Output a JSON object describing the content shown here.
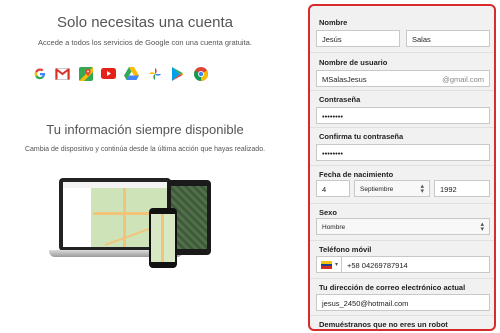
{
  "left": {
    "title1": "Solo necesitas una cuenta",
    "subtitle1": "Accede a todos los servicios de Google con una cuenta gratuita.",
    "title2": "Tu información siempre disponible",
    "subtitle2": "Cambia de dispositivo y continúa desde la última acción que hayas realizado.",
    "icons": [
      "google-icon",
      "gmail-icon",
      "maps-icon",
      "youtube-icon",
      "drive-icon",
      "photos-icon",
      "play-icon",
      "chrome-icon"
    ]
  },
  "form": {
    "name_label": "Nombre",
    "first_name": "Jesús",
    "last_name": "Salas",
    "username_label": "Nombre de usuario",
    "username": "MSalasJesus",
    "username_suffix": "@gmail.com",
    "password_label": "Contraseña",
    "password": "••••••••",
    "confirm_label": "Confirma tu contraseña",
    "confirm": "••••••••",
    "birth_label": "Fecha de nacimiento",
    "birth_day": "4",
    "birth_month": "Septiembre",
    "birth_year": "1992",
    "gender_label": "Sexo",
    "gender": "Hombre",
    "phone_label": "Teléfono móvil",
    "phone": "+58 04269787914",
    "email_label": "Tu dirección de correo electrónico actual",
    "email": "jesus_2450@hotmail.com",
    "captcha_label": "Demuéstranos que no eres un robot"
  },
  "colors": {
    "accent_border": "#d92b2b"
  }
}
